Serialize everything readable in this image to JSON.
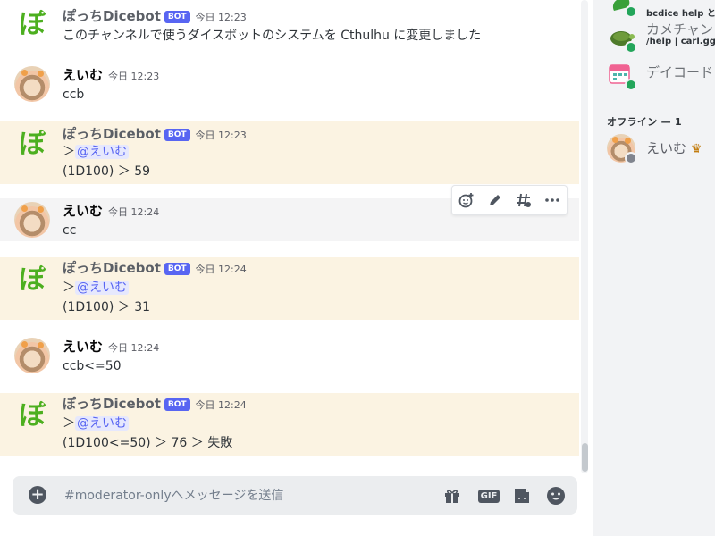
{
  "chat": {
    "messages": [
      {
        "author": "ぽっちDicebot",
        "bot": true,
        "tag": "BOT",
        "time": "今日 12:23",
        "avatar_glyph": "ぽ",
        "lines": [
          "このチャンネルで使うダイスボットのシステムを Cthulhu に変更しました"
        ],
        "highlight": false
      },
      {
        "author": "えいむ",
        "bot": false,
        "time": "今日 12:23",
        "lines": [
          "ccb"
        ],
        "highlight": false
      },
      {
        "author": "ぽっちDicebot",
        "bot": true,
        "tag": "BOT",
        "time": "今日 12:23",
        "avatar_glyph": "ぽ",
        "prefix": "＞",
        "mention": "@えいむ",
        "lines": [
          "(1D100) ＞ 59"
        ],
        "highlight": true
      },
      {
        "author": "えいむ",
        "bot": false,
        "time": "今日 12:24",
        "lines": [
          "cc"
        ],
        "highlight": false,
        "hover": true
      },
      {
        "author": "ぽっちDicebot",
        "bot": true,
        "tag": "BOT",
        "time": "今日 12:24",
        "avatar_glyph": "ぽ",
        "prefix": "＞",
        "mention": "@えいむ",
        "lines": [
          "(1D100) ＞ 31"
        ],
        "highlight": true
      },
      {
        "author": "えいむ",
        "bot": false,
        "time": "今日 12:24",
        "lines": [
          "ccb<=50"
        ],
        "highlight": false
      },
      {
        "author": "ぽっちDicebot",
        "bot": true,
        "tag": "BOT",
        "time": "今日 12:24",
        "avatar_glyph": "ぽ",
        "prefix": "＞",
        "mention": "@えいむ",
        "lines": [
          "(1D100<=50) ＞ 76 ＞ 失敗"
        ],
        "highlight": true
      }
    ]
  },
  "toolbar": {
    "icons": [
      "add-reaction-icon",
      "edit-icon",
      "thread-icon",
      "more-icon"
    ]
  },
  "composer": {
    "placeholder": "#moderator-onlyへメッセージを送信",
    "gif_label": "GIF",
    "icons": [
      "plus-icon",
      "gift-icon",
      "gif-icon",
      "sticker-icon",
      "emoji-icon"
    ]
  },
  "members": {
    "online": [
      {
        "name": "",
        "sub": "bcdice help と...",
        "avatar": "green-bot",
        "status": "online"
      },
      {
        "name": "カメチャン",
        "sub": "/help | carl.gg?...",
        "avatar": "turtle",
        "status": "online"
      },
      {
        "name": "デイコード",
        "sub": "",
        "avatar": "calendar",
        "status": "online"
      }
    ],
    "offline_header": "オフライン — 1",
    "offline": [
      {
        "name": "えいむ",
        "crown": "♛",
        "status": "offline"
      }
    ]
  },
  "colors": {
    "bot_highlight_bg": "#fbf3e2",
    "mention": "#5865f2",
    "bot_tag": "#5865f2",
    "online": "#23a55a",
    "crown": "#c27c0e"
  }
}
